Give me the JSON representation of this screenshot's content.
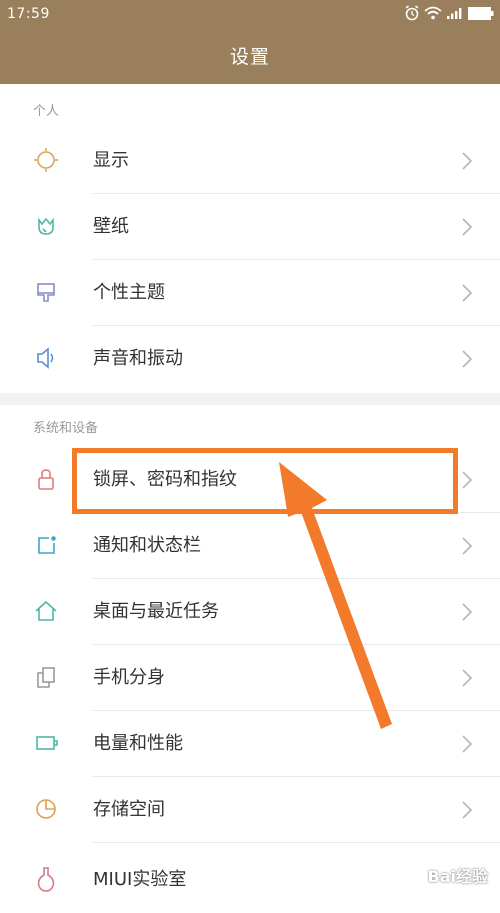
{
  "status_bar": {
    "time": "17:59"
  },
  "page_title": "设置",
  "sections": [
    {
      "label": "个人",
      "items": [
        {
          "label": "显示",
          "icon": "sun-icon"
        },
        {
          "label": "壁纸",
          "icon": "tulip-icon"
        },
        {
          "label": "个性主题",
          "icon": "paint-brush-icon"
        },
        {
          "label": "声音和振动",
          "icon": "speaker-icon"
        }
      ]
    },
    {
      "label": "系统和设备",
      "items": [
        {
          "label": "锁屏、密码和指纹",
          "icon": "lock-icon"
        },
        {
          "label": "通知和状态栏",
          "icon": "notification-icon"
        },
        {
          "label": "桌面与最近任务",
          "icon": "home-icon"
        },
        {
          "label": "手机分身",
          "icon": "dual-app-icon"
        },
        {
          "label": "电量和性能",
          "icon": "battery-icon"
        },
        {
          "label": "存储空间",
          "icon": "storage-pie-icon"
        },
        {
          "label": "MIUI实验室",
          "icon": "flask-icon"
        }
      ]
    }
  ],
  "annotation_color": "#f27a2a",
  "header_color": "#9a7f5d",
  "watermark": "Bai经验"
}
